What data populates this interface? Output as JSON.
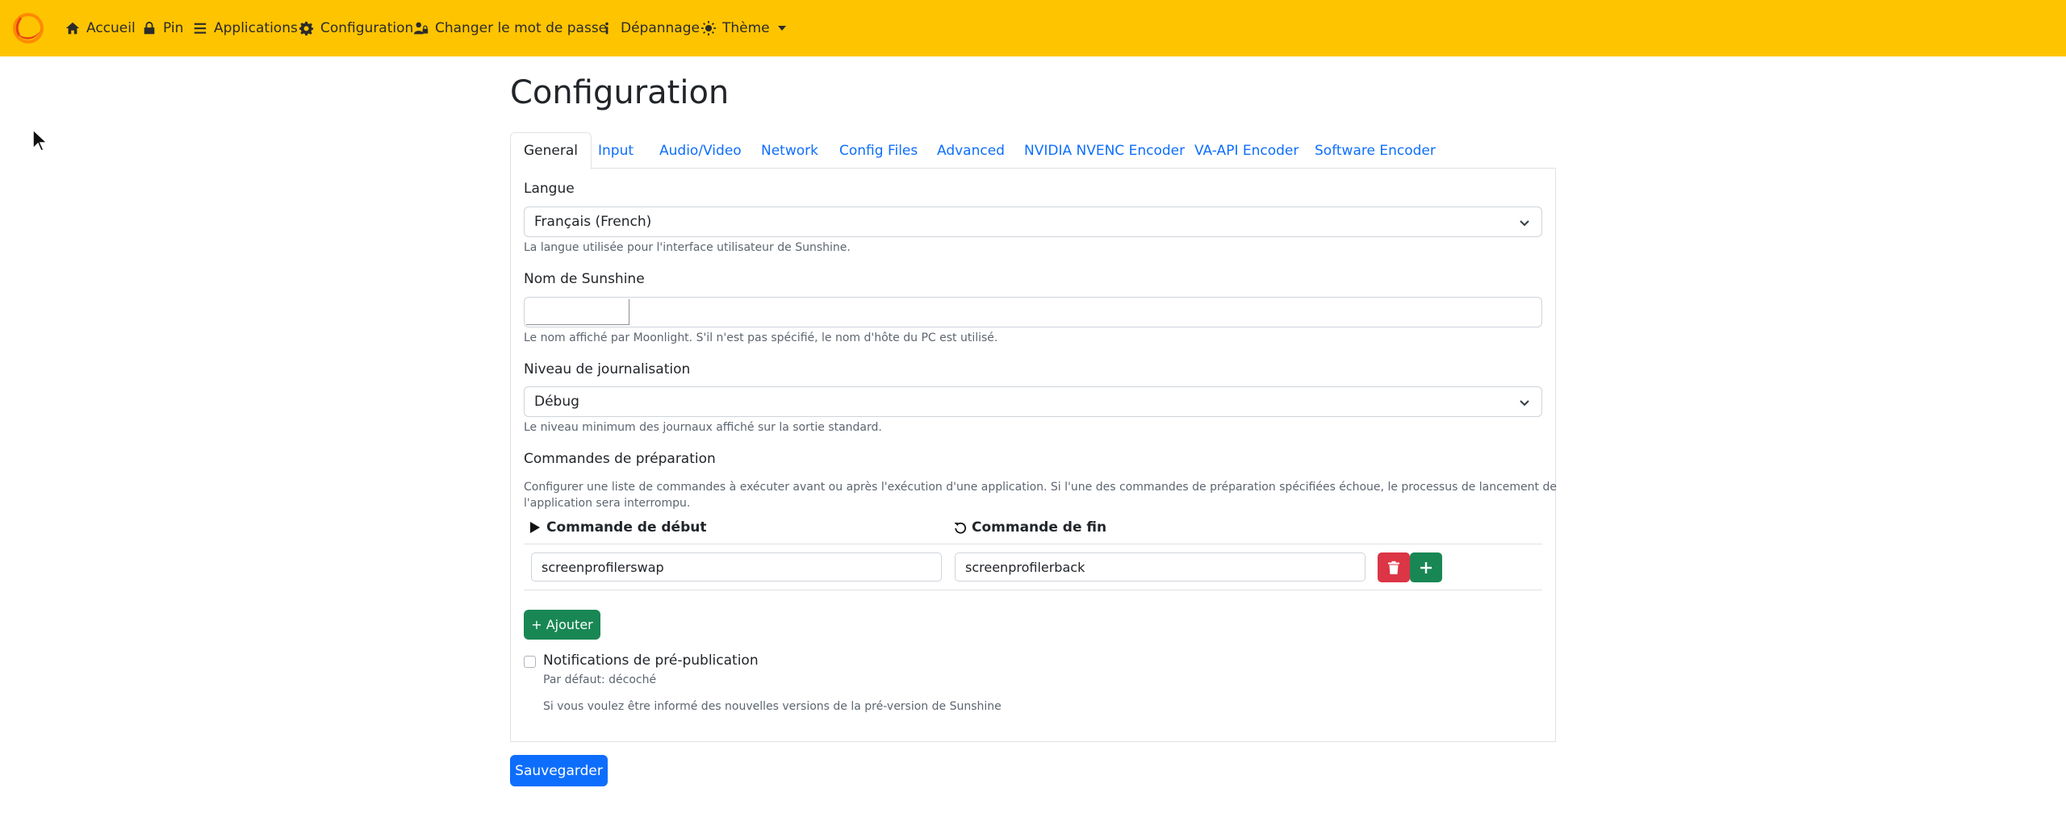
{
  "navbar": {
    "items": [
      {
        "label": "Accueil",
        "icon": "home-icon"
      },
      {
        "label": "Pin",
        "icon": "lock-icon"
      },
      {
        "label": "Applications",
        "icon": "list-icon"
      },
      {
        "label": "Configuration",
        "icon": "gear-icon"
      },
      {
        "label": "Changer le mot de passe",
        "icon": "user-lock-icon"
      },
      {
        "label": "Dépannage",
        "icon": "info-icon"
      },
      {
        "label": "Thème",
        "icon": "theme-icon"
      }
    ],
    "brand_color": "#ffc400"
  },
  "page": {
    "title": "Configuration"
  },
  "tabs": [
    {
      "label": "General",
      "active": true
    },
    {
      "label": "Input"
    },
    {
      "label": "Audio/Video"
    },
    {
      "label": "Network"
    },
    {
      "label": "Config Files"
    },
    {
      "label": "Advanced"
    },
    {
      "label": "NVIDIA NVENC Encoder"
    },
    {
      "label": "VA-API Encoder"
    },
    {
      "label": "Software Encoder"
    }
  ],
  "general": {
    "language": {
      "label": "Langue",
      "value": "Français (French)",
      "help": "La langue utilisée pour l'interface utilisateur de Sunshine."
    },
    "name": {
      "label": "Nom de Sunshine",
      "value": "",
      "help": "Le nom affiché par Moonlight. S'il n'est pas spécifié, le nom d'hôte du PC est utilisé."
    },
    "log_level": {
      "label": "Niveau de journalisation",
      "value": "Débug",
      "help": "Le niveau minimum des journaux affiché sur la sortie standard."
    },
    "prep_commands": {
      "label": "Commandes de préparation",
      "help_line1": "Configurer une liste de commandes à exécuter avant ou après l'exécution d'une application. Si l'une des commandes de préparation spécifiées échoue, le processus de lancement de",
      "help_line2": "l'application sera interrompu.",
      "col_start": "Commande de début",
      "col_end": "Commande de fin",
      "rows": [
        {
          "do": "screenprofilerswap",
          "undo": "screenprofilerback"
        }
      ],
      "add_label": "+ Ajouter"
    },
    "prerelease": {
      "label": "Notifications de pré-publication",
      "default_text": "Par défaut: décoché",
      "help": "Si vous voulez être informé des nouvelles versions de la pré-version de Sunshine",
      "checked": false
    }
  },
  "save_label": "Sauvegarder",
  "colors": {
    "primary": "#0d6efd",
    "success": "#198754",
    "danger": "#dc3545"
  }
}
